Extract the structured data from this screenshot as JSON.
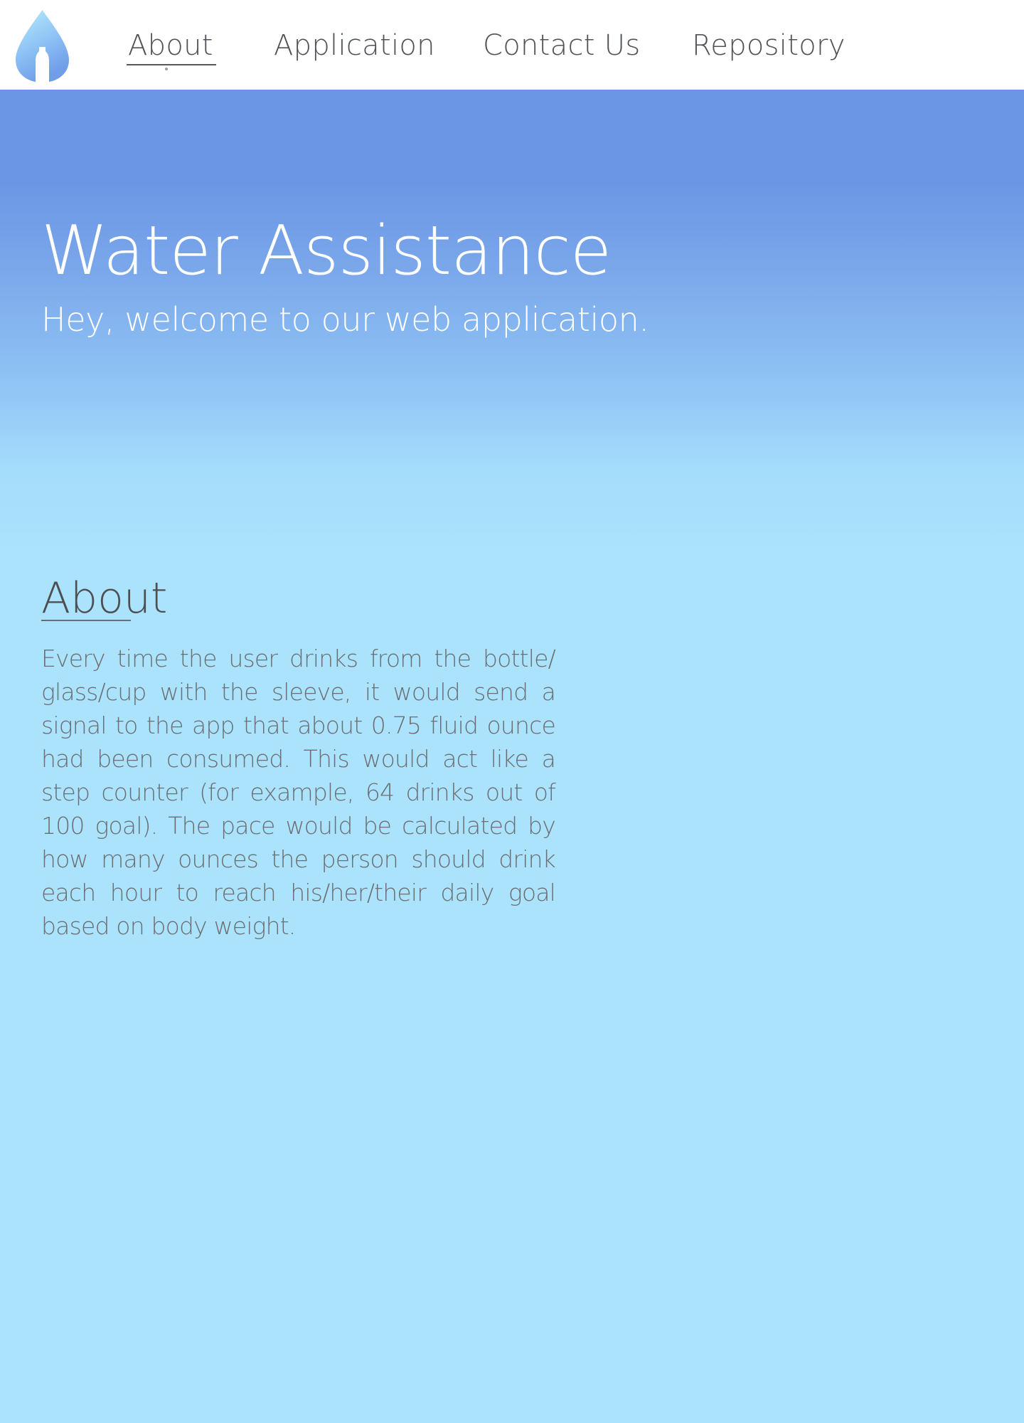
{
  "nav": {
    "logo_icon": "water-drop-bottle-icon",
    "items": [
      {
        "label": "About",
        "active": true
      },
      {
        "label": "Application",
        "active": false
      },
      {
        "label": "Contact Us",
        "active": false
      },
      {
        "label": "Repository",
        "active": false
      }
    ]
  },
  "hero": {
    "title": "Water Assistance",
    "subtitle": "Hey, welcome to our web application."
  },
  "about": {
    "heading": "About",
    "body": "Every time the user drinks from the bottle/ glass/cup with the sleeve, it would send a signal to the app that about 0.75 fluid ounce had been consumed. This would act like a step counter (for example, 64 drinks out of 100 goal). The pace would be calculated by how many ounces the person should drink each hour to reach his/her/their daily goal based on body weight."
  },
  "colors": {
    "hero_top": "#6b96e5",
    "page_background": "#abe2fc",
    "nav_text": "#4f5256",
    "body_text": "#6b6f73"
  }
}
